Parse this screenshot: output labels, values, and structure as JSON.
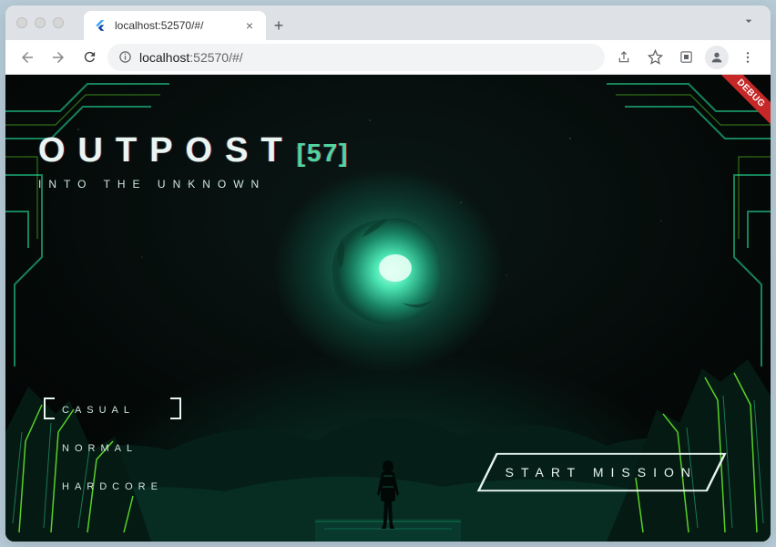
{
  "browser": {
    "tab_title": "localhost:52570/#/",
    "url_display_host": "localhost",
    "url_display_rest": ":52570/#/",
    "new_tab_label": "+",
    "close_tab_label": "×"
  },
  "debug_banner": "DEBUG",
  "title": {
    "main": "OUTPOST",
    "id": "[57]",
    "subtitle": "INTO THE UNKNOWN"
  },
  "difficulty": {
    "options": [
      {
        "label": "CASUAL",
        "selected": true
      },
      {
        "label": "NORMAL",
        "selected": false
      },
      {
        "label": "HARDCORE",
        "selected": false
      }
    ]
  },
  "start_button": "START MISSION",
  "colors": {
    "accent_green": "#2dd695",
    "neon_lime": "#6eff2e",
    "dark_teal": "#0b3a2e"
  }
}
